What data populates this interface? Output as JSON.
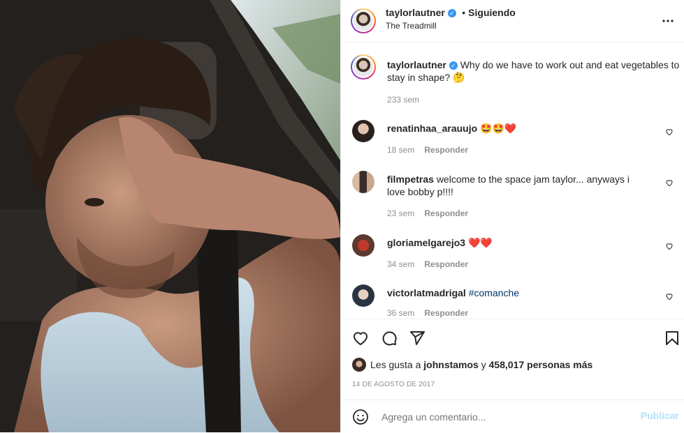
{
  "post": {
    "username": "taylorlautner",
    "follow_status": "Siguiendo",
    "separator": "•",
    "location": "The Treadmill",
    "more_icon": "more-horizontal-icon"
  },
  "caption": {
    "username": "taylorlautner",
    "text": "Why do we have to work out and eat vegetables to stay in shape? 🤔",
    "time": "233 sem"
  },
  "comments": [
    {
      "username": "renatinhaa_arauujo",
      "text": "🤩🤩❤️",
      "time": "18 sem",
      "reply": "Responder"
    },
    {
      "username": "filmpetras",
      "text": "welcome to the space jam taylor... anyways i love bobby p!!!!",
      "time": "23 sem",
      "reply": "Responder"
    },
    {
      "username": "gloriamelgarejo3",
      "text": "❤️❤️",
      "time": "34 sem",
      "reply": "Responder"
    },
    {
      "username": "victorlatmadrigal",
      "text": "#comanche",
      "time": "36 sem",
      "reply": "Responder"
    }
  ],
  "likes": {
    "prefix": "Les gusta a",
    "user": "johnstamos",
    "middle": "y",
    "count": "458,017 personas más"
  },
  "date": "14 DE AGOSTO DE 2017",
  "add_comment": {
    "placeholder": "Agrega un comentario...",
    "submit": "Publicar"
  },
  "colors": {
    "verified": "#3897f0",
    "link": "#00376b",
    "publish_disabled": "#b2dffc",
    "muted": "#8e8e8e"
  }
}
